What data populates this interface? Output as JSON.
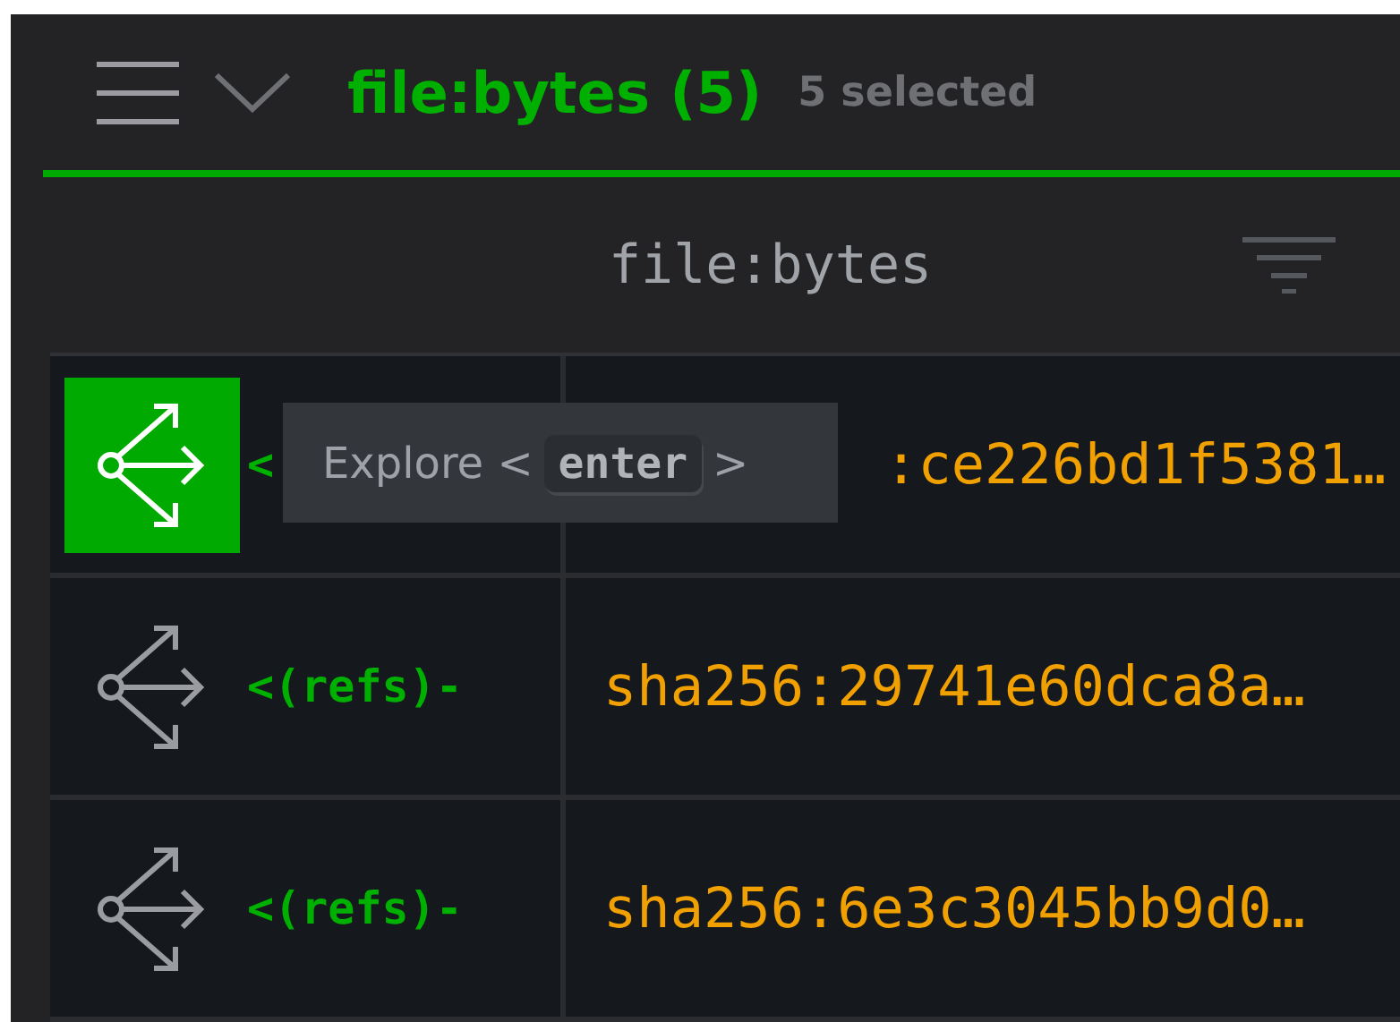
{
  "header": {
    "title": "file:bytes (5)",
    "selection_count": "5 selected"
  },
  "table": {
    "columns": [
      {
        "label": "file:bytes"
      }
    ],
    "rows": [
      {
        "selected": true,
        "refs": "<",
        "hash": ":ce226bd1f5381…"
      },
      {
        "selected": false,
        "refs": "<(refs)-",
        "hash": "sha256:29741e60dca8a…"
      },
      {
        "selected": false,
        "refs": "<(refs)-",
        "hash": "sha256:6e3c3045bb9d0…"
      }
    ]
  },
  "tooltip": {
    "text": "Explore <",
    "key": "enter",
    "suffix": ">"
  }
}
